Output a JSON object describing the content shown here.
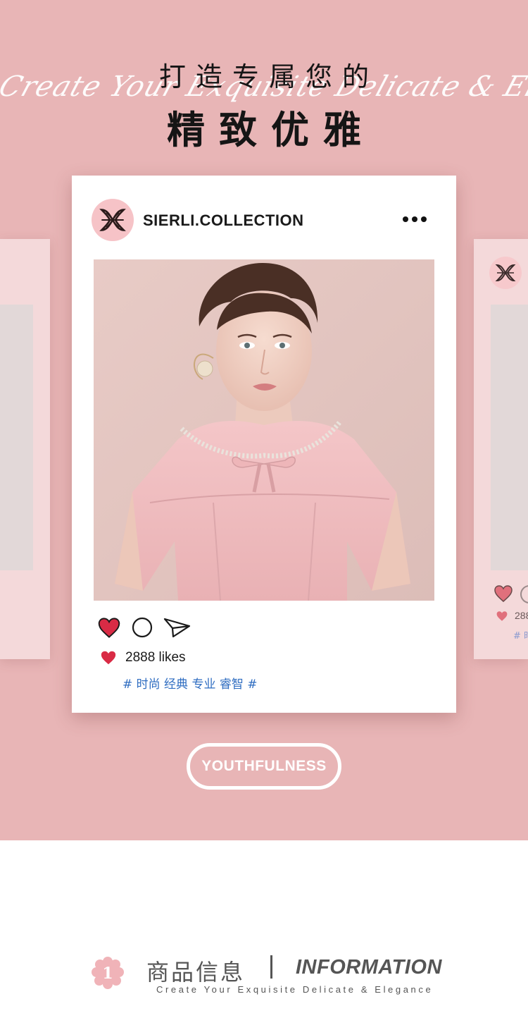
{
  "hero": {
    "title_line1": "打造专属您的",
    "title_line2": "精致优雅",
    "script_text": "Create Your Exquisite Delicate & Elegance",
    "background_color": "#e8b5b6"
  },
  "post": {
    "account_name": "SIERLI.COLLECTION",
    "avatar_logo": "sierli-monogram-logo",
    "more_icon": "more-dots-icon",
    "photo_description": "model-in-pink-dress-photo",
    "action_icons": [
      "heart-icon",
      "comment-icon",
      "share-icon"
    ],
    "likes_text": "2888 likes",
    "hashtags": "# 时尚 经典 专业 睿智 #",
    "heart_color": "#d92b45",
    "hashtag_color": "#2f6dc1"
  },
  "side_post": {
    "likes_text": "288",
    "hashtags": "# 时"
  },
  "badge": {
    "label": "YOUTHFULNESS"
  },
  "info_header": {
    "number": "1",
    "title_cn": "商品信息",
    "title_en": "INFORMATION",
    "subtitle": "Create Your Exquisite Delicate & Elegance",
    "flower_color": "#f0b3b8"
  }
}
